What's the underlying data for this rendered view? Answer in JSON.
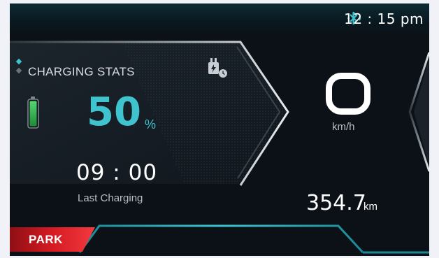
{
  "status_bar": {
    "time": "12 : 15 pm",
    "bluetooth_icon": "bluetooth-icon"
  },
  "charging": {
    "title": "CHARGING STATS",
    "battery_percent": "50",
    "percent_unit": "%",
    "battery_level": 0.5,
    "last_charging_time": "09 : 00",
    "last_charging_label": "Last Charging",
    "plug_icon": "charging-plug-timer-icon"
  },
  "speed": {
    "value": "0",
    "unit": "km/h"
  },
  "odometer": {
    "value": "354.7",
    "unit": "km"
  },
  "gear": {
    "mode": "PARK"
  },
  "colors": {
    "accent_teal": "#3fc3ce",
    "battery_green": "#34c759",
    "park_red": "#d61a22",
    "background": "#0b1117"
  }
}
